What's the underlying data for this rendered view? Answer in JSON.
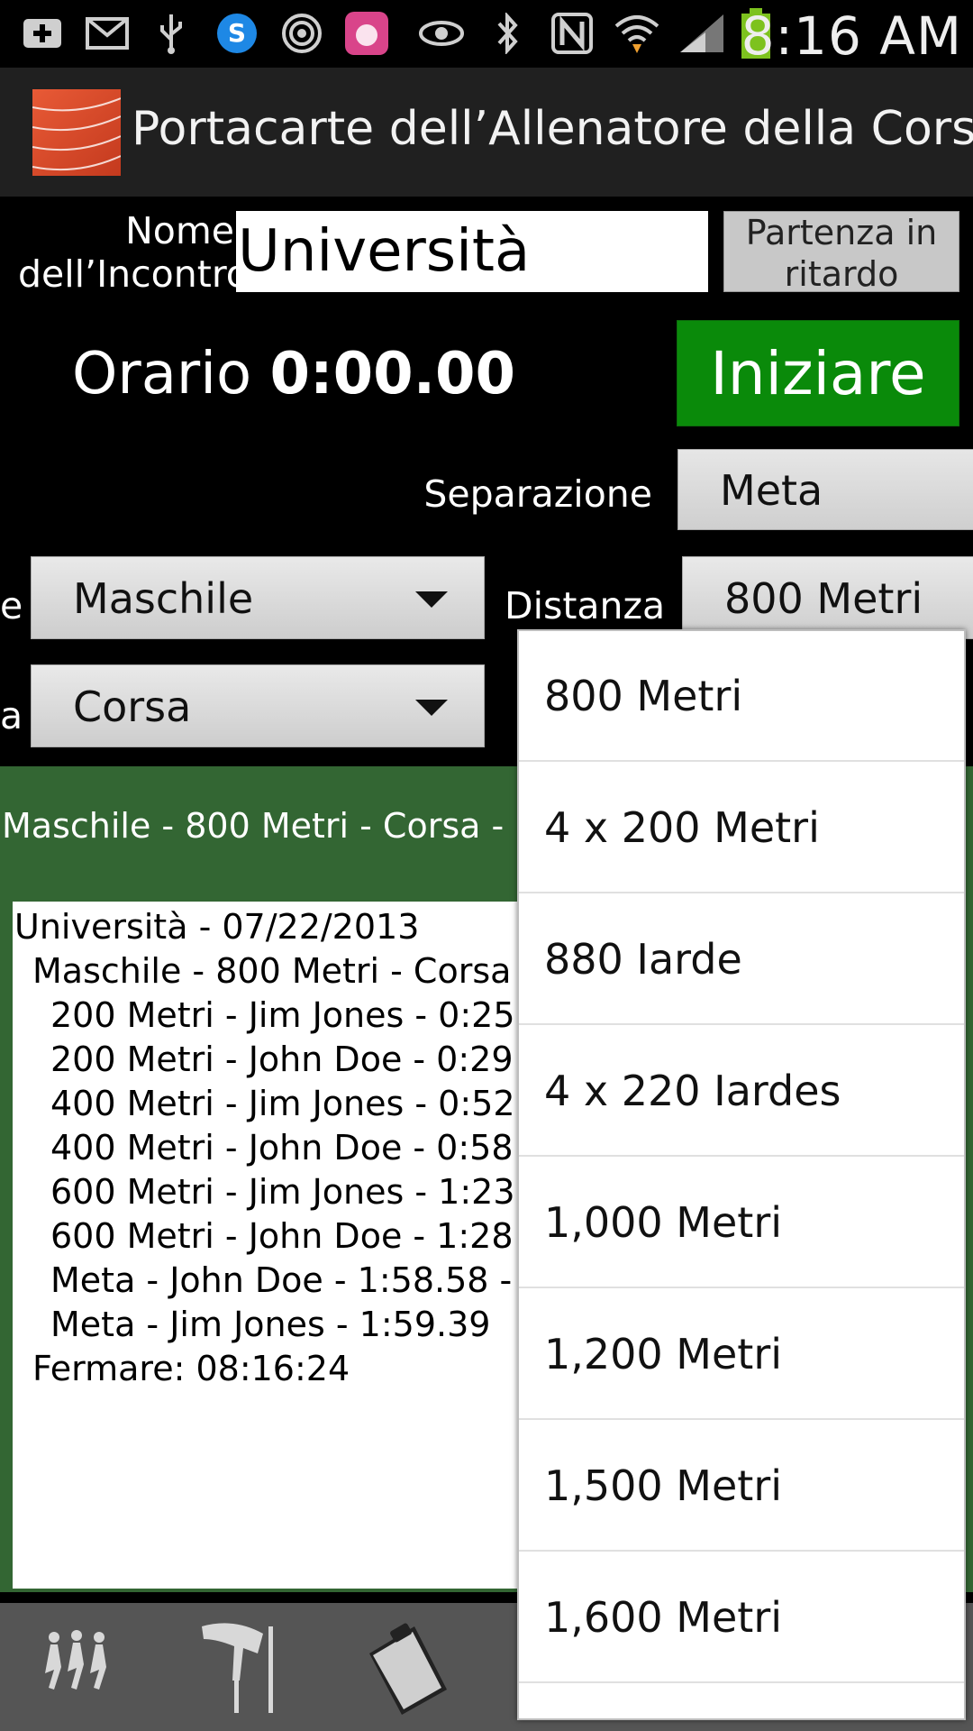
{
  "status_bar": {
    "time": "8:16 AM",
    "icons": [
      "add-icon",
      "mail-icon",
      "usb-icon",
      "skype-icon",
      "nfc-signal-icon",
      "app-icon",
      "eye-icon",
      "bluetooth-icon",
      "n-icon",
      "wifi-icon",
      "signal-icon",
      "battery-icon"
    ]
  },
  "app": {
    "title": "Portacarte dell’Allenatore della Corsa",
    "accent_green": "#0a8a0a",
    "panel_green": "#336633"
  },
  "form": {
    "meet_name_label_line1": "Nome",
    "meet_name_label_line2": "dell’Incontro",
    "meet_name_value": "Università",
    "late_start_label": "Partenza in ritardo",
    "time_label": "Orario",
    "time_value": "0:00.00",
    "start_label": "Iniziare",
    "split_label": "Separazione",
    "split_value": "Meta",
    "gender_label_fragment": "e",
    "gender_value": "Maschile",
    "event_label_fragment": "a",
    "event_value": "Corsa",
    "distance_label": "Distanza",
    "distance_value": "800 Metri"
  },
  "results": {
    "summary": "Maschile - 800 Metri - Corsa -",
    "log_lines": [
      "Università - 07/22/2013",
      "Maschile - 800 Metri - Corsa",
      "200 Metri - Jim Jones - 0:25",
      "200 Metri - John Doe - 0:29",
      "400 Metri - Jim Jones - 0:52",
      "400 Metri - John Doe - 0:58",
      "600 Metri - Jim Jones - 1:23",
      "600 Metri - John Doe - 1:28",
      "Meta - John Doe - 1:58.58 -",
      "Meta - Jim Jones - 1:59.39",
      "Fermare: 08:16:24"
    ]
  },
  "bottom_nav": {
    "icons": [
      "runners-icon",
      "high-jump-icon",
      "clipboard-icon"
    ]
  },
  "distance_dropdown": {
    "options": [
      "800 Metri",
      "4 x 200 Metri",
      "880 Iarde",
      "4 x 220 Iardes",
      "1,000 Metri",
      "1,200 Metri",
      "1,500 Metri",
      "1,600 Metri"
    ]
  }
}
